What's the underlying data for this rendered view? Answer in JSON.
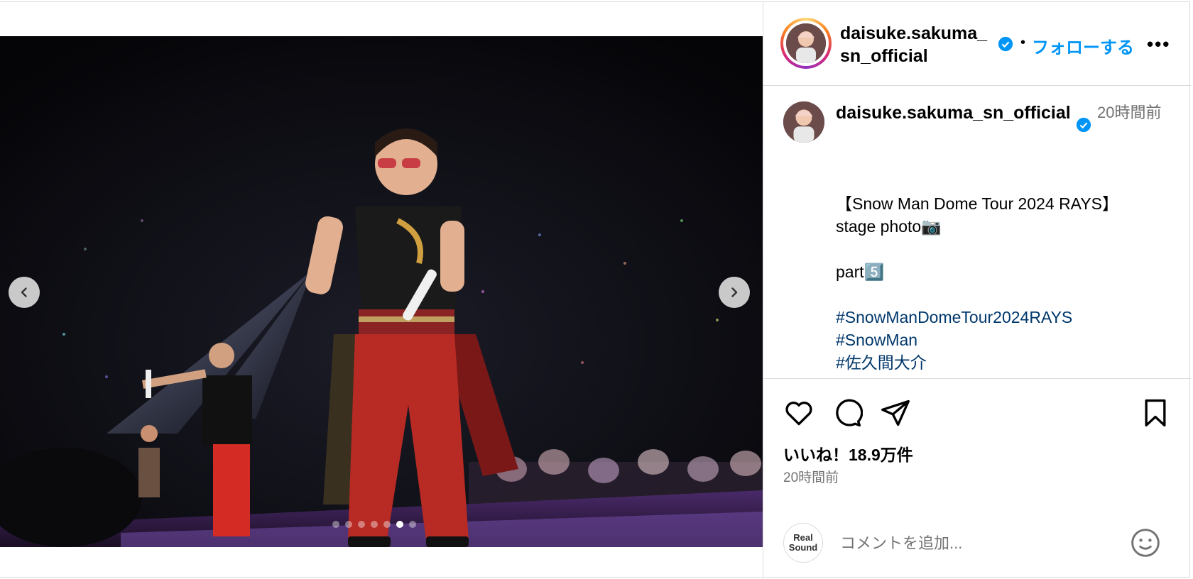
{
  "post": {
    "username_header": "daisuke.sakuma_sn_official",
    "follow_label": "フォローする",
    "separator": "•",
    "more_label": "•••"
  },
  "media": {
    "description_icon": "concert-stage-photo",
    "prev_icon": "chevron-left-icon",
    "next_icon": "chevron-right-icon",
    "carousel_total": 7,
    "carousel_active_index": 5
  },
  "caption": {
    "username": "daisuke.sakuma_sn_official",
    "time": "20時間前",
    "lines": [
      "【Snow Man Dome Tour 2024 RAYS】",
      "stage photo📷",
      "",
      "part5️⃣",
      "",
      "#SnowManDomeTour2024RAYS",
      "#SnowMan",
      "#佐久間大介"
    ]
  },
  "actions": {
    "likes_text": "いいね！18.9万件",
    "posted_ago": "20時間前",
    "comment_placeholder": "コメントを追加...",
    "viewer_logo_line1": "Real",
    "viewer_logo_line2": "Sound"
  },
  "colors": {
    "accent": "#0095f6",
    "hashtag": "#00376b",
    "muted": "#737373",
    "border": "#dbdbdb"
  }
}
